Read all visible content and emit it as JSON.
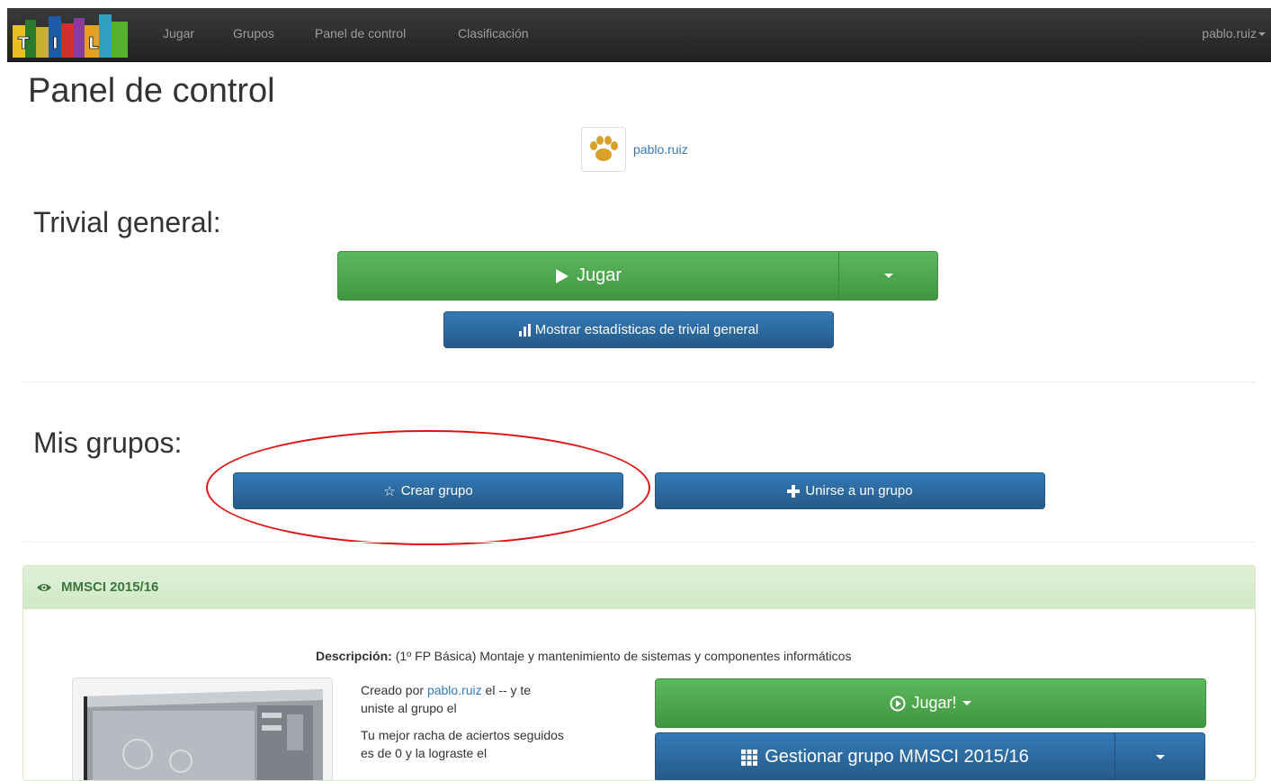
{
  "navbar": {
    "links": [
      "Jugar",
      "Grupos",
      "Panel de control",
      "Clasificación"
    ],
    "user": "pablo.ruiz"
  },
  "page_title": "Panel de control",
  "profile": {
    "username": "pablo.ruiz",
    "avatar_icon": "paw-icon"
  },
  "trivial_general": {
    "title": "Trivial general:",
    "play_label": "Jugar",
    "stats_label": "Mostrar estadísticas de trivial general"
  },
  "mis_grupos": {
    "title": "Mis grupos:",
    "create_label": "Crear grupo",
    "join_label": "Unirse a un grupo"
  },
  "group": {
    "name": "MMSCI 2015/16",
    "description_label": "Descripción:",
    "description_text": "(1º FP Básica) Montaje y mantenimiento de sistemas y componentes informáticos",
    "created_by_prefix": "Creado por",
    "created_by_user": "pablo.ruiz",
    "created_by_suffix_1": "el  --  y te",
    "created_by_suffix_2": "uniste al grupo el",
    "streak_line_1": "Tu mejor racha de aciertos seguidos",
    "streak_line_2": "es de   0  y la lograste el",
    "play_label": "Jugar!",
    "manage_label": "Gestionar grupo MMSCI 2015/16"
  },
  "colors": {
    "navbar": "#222222",
    "success": "#5cb85c",
    "primary": "#337ab7",
    "highlight": "#e01010",
    "panel_heading": "#dff0d8"
  }
}
